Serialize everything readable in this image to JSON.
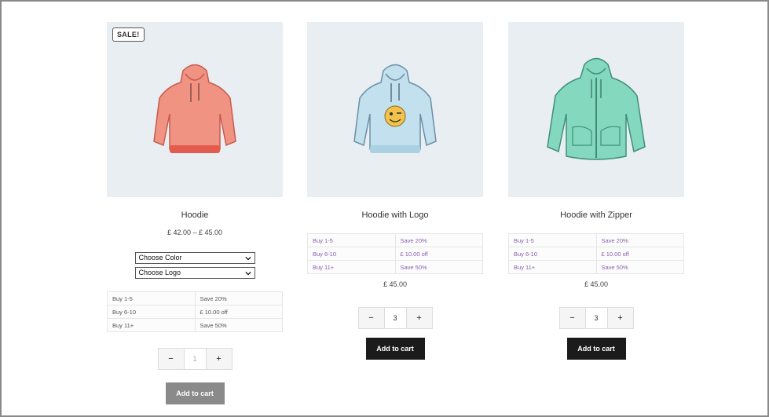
{
  "products": [
    {
      "sale_badge": "SALE!",
      "image_icon": "hoodie-icon",
      "color": "#ee8a7c",
      "title": "Hoodie",
      "price": "£ 42.00 – £ 45.00",
      "selects": [
        "Choose Color",
        "Choose Logo"
      ],
      "tiers": [
        {
          "qty": "Buy 1-5",
          "deal": "Save 20%"
        },
        {
          "qty": "Buy 6-10",
          "deal": "£ 10.00 off"
        },
        {
          "qty": "Buy 11+",
          "deal": "Save 50%"
        }
      ],
      "quantity": "1",
      "cart_label": "Add to cart"
    },
    {
      "image_icon": "hoodie-with-logo-icon",
      "color": "#bcdcec",
      "title": "Hoodie with Logo",
      "price": "£ 45.00",
      "tiers": [
        {
          "qty": "Buy 1-5",
          "deal": "Save 20%"
        },
        {
          "qty": "Buy 6-10",
          "deal": "£ 10.00 off"
        },
        {
          "qty": "Buy 11+",
          "deal": "Save 50%"
        }
      ],
      "quantity": "3",
      "cart_label": "Add to cart"
    },
    {
      "image_icon": "hoodie-with-zipper-icon",
      "color": "#7fd6bd",
      "title": "Hoodie with Zipper",
      "price": "£ 45.00",
      "tiers": [
        {
          "qty": "Buy 1-5",
          "deal": "Save 20%"
        },
        {
          "qty": "Buy 6-10",
          "deal": "£ 10.00 off"
        },
        {
          "qty": "Buy 11+",
          "deal": "Save 50%"
        }
      ],
      "quantity": "3",
      "cart_label": "Add to cart"
    }
  ],
  "qty_minus": "−",
  "qty_plus": "+"
}
